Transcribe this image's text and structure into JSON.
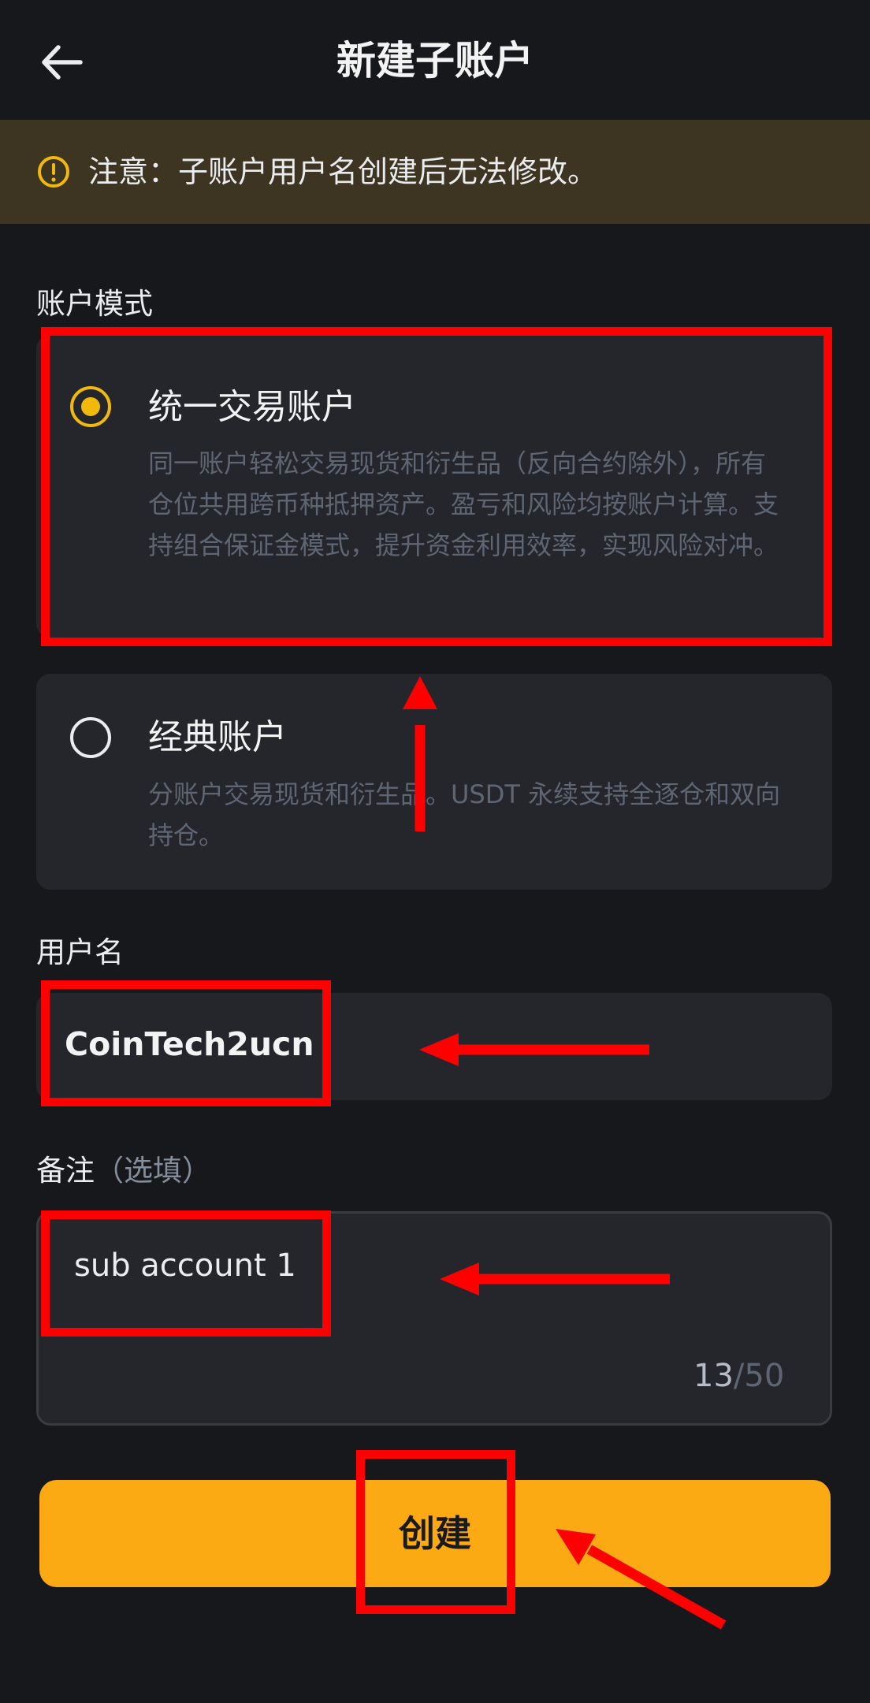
{
  "header": {
    "title": "新建子账户",
    "back_icon": "arrow-left-icon"
  },
  "notice": {
    "icon": "warning-circle-icon",
    "text": "注意：子账户用户名创建后无法修改。"
  },
  "account_mode": {
    "label": "账户模式",
    "options": [
      {
        "title": "统一交易账户",
        "description": "同一账户轻松交易现货和衍生品（反向合约除外），所有仓位共用跨币种抵押资产。盈亏和风险均按账户计算。支持组合保证金模式，提升资金利用效率，实现风险对冲。",
        "selected": true
      },
      {
        "title": "经典账户",
        "description": "分账户交易现货和衍生品。USDT 永续支持全逐仓和双向持仓。",
        "selected": false
      }
    ]
  },
  "username": {
    "label": "用户名",
    "value": "CoinTech2ucn"
  },
  "remark": {
    "label": "备注",
    "optional": "（选填）",
    "value": "sub account 1",
    "count": "13",
    "max": "/50"
  },
  "create_button": {
    "label": "创建"
  },
  "colors": {
    "background": "#17181c",
    "notice_bg": "#3d3422",
    "card_bg": "#25262c",
    "accent": "#f0b90b",
    "button": "#fcaa13",
    "annotation": "#ff0000"
  }
}
